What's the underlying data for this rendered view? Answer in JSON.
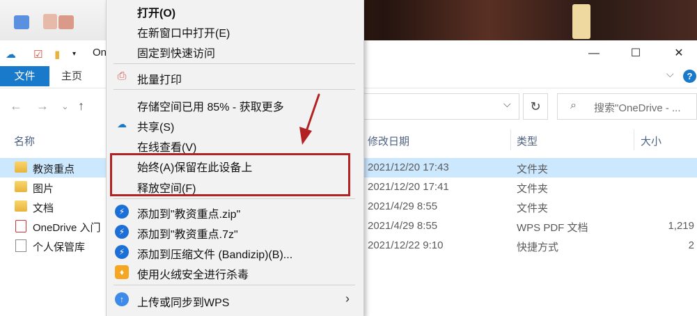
{
  "window": {
    "title_fragment": "On",
    "minimize": "—",
    "maximize": "☐",
    "close": "✕"
  },
  "ribbon": {
    "tab_file": "文件",
    "tab_home": "主页",
    "expand": "⌵",
    "help": "?"
  },
  "nav": {
    "back": "←",
    "forward": "→",
    "recent": "⌄",
    "up": "↑",
    "address_dropdown": "⌵",
    "refresh": "↻",
    "search_placeholder": "搜索\"OneDrive - ..."
  },
  "columns": {
    "name": "名称",
    "modified": "修改日期",
    "type": "类型",
    "size": "大小"
  },
  "files": [
    {
      "name": "教资重点",
      "modified": "2021/12/20 17:43",
      "type": "文件夹",
      "size": "",
      "icon": "folder-icon",
      "selected": true
    },
    {
      "name": "图片",
      "modified": "2021/12/20 17:41",
      "type": "文件夹",
      "size": "",
      "icon": "folder-icon",
      "selected": false
    },
    {
      "name": "文档",
      "modified": "2021/4/29 8:55",
      "type": "文件夹",
      "size": "",
      "icon": "folder-icon",
      "selected": false
    },
    {
      "name": "OneDrive 入门",
      "modified": "2021/4/29 8:55",
      "type": "WPS PDF 文档",
      "size": "1,219",
      "icon": "pdf-icon",
      "selected": false
    },
    {
      "name": "个人保管库",
      "modified": "2021/12/22 9:10",
      "type": "快捷方式",
      "size": "2",
      "icon": "shortcut-icon",
      "selected": false
    }
  ],
  "context_menu": {
    "open": "打开(O)",
    "open_new_window": "在新窗口中打开(E)",
    "pin_quick_access": "固定到快速访问",
    "batch_print": "批量打印",
    "storage": "存储空间已用 85% - 获取更多",
    "share": "共享(S)",
    "view_online": "在线查看(V)",
    "always_keep": "始终(A)保留在此设备上",
    "free_space": "释放空间(F)",
    "add_zip": "添加到\"教资重点.zip\"",
    "add_7z": "添加到\"教资重点.7z\"",
    "add_archive": "添加到压缩文件 (Bandizip)(B)...",
    "antivirus": "使用火绒安全进行杀毒",
    "upload_wps": "上传或同步到WPS",
    "submenu_arrow": "›"
  },
  "colors": {
    "accent": "#1979ca",
    "selected_row": "#cce8ff",
    "highlight_box": "#b22222",
    "menu_bg": "#f2f2f2"
  }
}
